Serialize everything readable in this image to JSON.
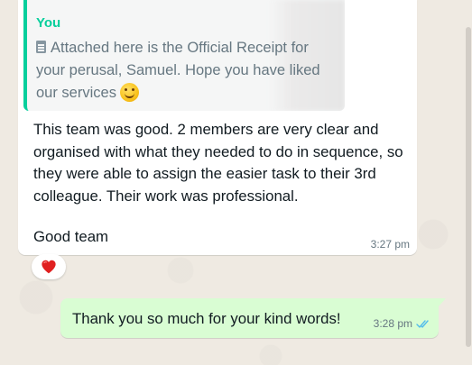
{
  "incoming_message": {
    "quoted": {
      "author": "You",
      "text": "Attached here is the Official Receipt for your perusal, Samuel. Hope you have liked our services",
      "document_icon": "document-icon",
      "emoji": "smiling-face-emoji"
    },
    "body": "This team was good. 2 members are very clear and organised with what they needed to do in sequence, so they were able to assign the easier task to their 3rd colleague. Their work was professional.",
    "closing": "Good team",
    "time": "3:27 pm",
    "reaction": "red-heart-emoji"
  },
  "outgoing_message": {
    "text": "Thank you so much for your kind words!",
    "time": "3:28 pm",
    "status_icon": "double-check-read-icon"
  },
  "colors": {
    "chat_background": "#efeae2",
    "incoming_bubble": "#ffffff",
    "outgoing_bubble": "#d9fdd3",
    "quote_accent": "#06cf9c",
    "read_tick": "#53bdeb",
    "heart": "#e02020"
  }
}
